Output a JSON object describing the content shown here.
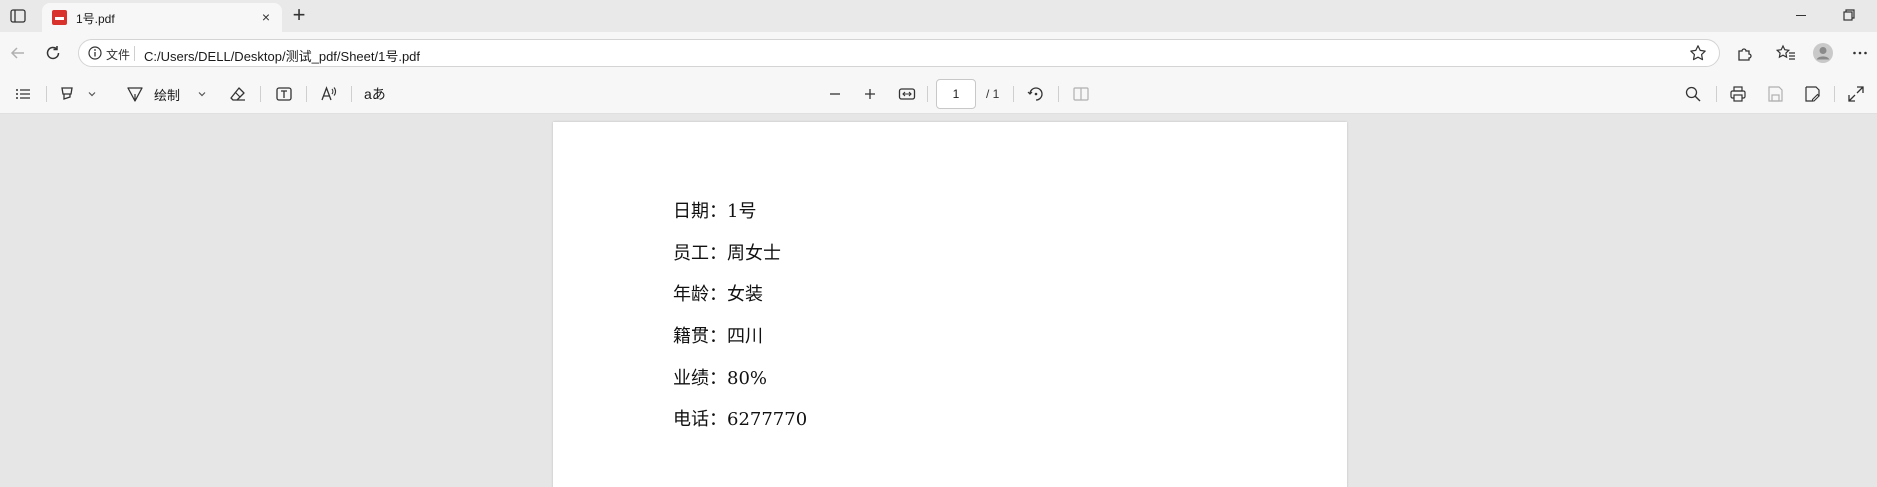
{
  "tab": {
    "title": "1号.pdf",
    "close_glyph": "×",
    "new_tab_glyph": "+"
  },
  "address_bar": {
    "security_label": "文件",
    "url": "C:/Users/DELL/Desktop/测试_pdf/Sheet/1号.pdf"
  },
  "pdf_toolbar": {
    "draw_label": "绘制",
    "read_aloud_label": "aあ",
    "page_current": "1",
    "page_total": "/ 1"
  },
  "document": {
    "lines": [
      "日期：1号",
      "员工：周女士",
      "年龄：女装",
      "籍贯：四川",
      "业绩：80%",
      "电话：6277770"
    ]
  },
  "icons": {
    "favicon": "pdf-icon",
    "tab_actions": "tab-actions-icon",
    "back": "back-arrow-icon",
    "refresh": "refresh-icon",
    "info": "info-icon",
    "favorite": "star-icon",
    "extensions": "puzzle-icon",
    "favorites": "favorites-icon",
    "profile": "avatar-icon",
    "more": "more-icon"
  },
  "colors": {
    "pdf_badge": "#d9322c",
    "toolbar_bg": "#f7f7f7",
    "viewer_bg": "#e6e6e6",
    "page_bg": "#ffffff"
  }
}
